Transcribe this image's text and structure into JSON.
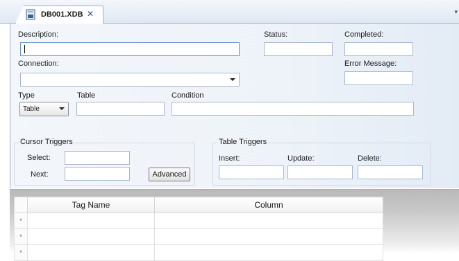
{
  "tab": {
    "title": "DB001.XDB",
    "close": "✕",
    "icon": "database-file-icon"
  },
  "form": {
    "description": {
      "label": "Description:",
      "value": ""
    },
    "status": {
      "label": "Status:",
      "value": ""
    },
    "completed": {
      "label": "Completed:",
      "value": ""
    },
    "connection": {
      "label": "Connection:",
      "value": ""
    },
    "error_message": {
      "label": "Error Message:",
      "value": ""
    },
    "type": {
      "label": "Type",
      "value": "Table"
    },
    "table": {
      "label": "Table",
      "value": ""
    },
    "condition": {
      "label": "Condition",
      "value": ""
    },
    "cursor_triggers": {
      "title": "Cursor Triggers",
      "select_label": "Select:",
      "next_label": "Next:",
      "advanced_label": "Advanced"
    },
    "table_triggers": {
      "title": "Table Triggers",
      "insert_label": "Insert:",
      "update_label": "Update:",
      "delete_label": "Delete:"
    }
  },
  "grid": {
    "columns": [
      "Tag Name",
      "Column"
    ],
    "row_marker": "*",
    "rows": [
      [
        "",
        ""
      ],
      [
        "",
        ""
      ],
      [
        "",
        ""
      ]
    ]
  },
  "colors": {
    "accent": "#9db0c9",
    "panel": "#eef3f9"
  }
}
